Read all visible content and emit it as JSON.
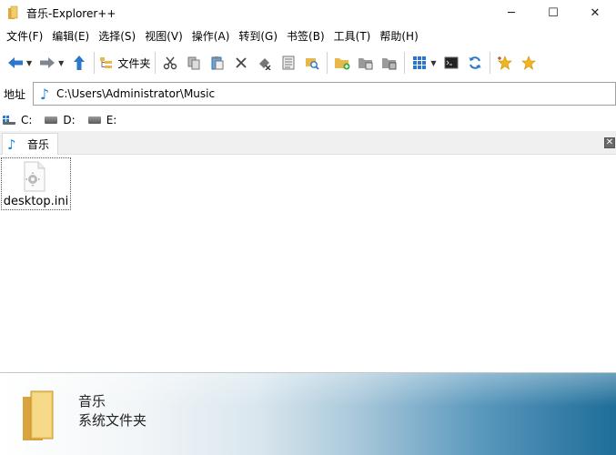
{
  "window": {
    "title": "音乐-Explorer++",
    "minimize_glyph": "─",
    "maximize_glyph": "☐",
    "close_glyph": "✕"
  },
  "menu": {
    "items": [
      "文件(F)",
      "编辑(E)",
      "选择(S)",
      "视图(V)",
      "操作(A)",
      "转到(G)",
      "书签(B)",
      "工具(T)",
      "帮助(H)"
    ]
  },
  "toolbar": {
    "folders_label": "文件夹",
    "icons": [
      "back-arrow-icon",
      "forward-arrow-icon",
      "up-arrow-icon",
      "folders-icon",
      "cut-icon",
      "copy-icon",
      "paste-icon",
      "delete-icon",
      "delete-permanently-icon",
      "properties-icon",
      "search-icon",
      "new-folder-icon",
      "copy-to-icon",
      "move-to-icon",
      "views-icon",
      "command-prompt-icon",
      "refresh-icon",
      "bookmark-add-icon",
      "bookmarks-icon"
    ]
  },
  "address": {
    "label": "地址",
    "value": "C:\\Users\\Administrator\\Music"
  },
  "drives": [
    {
      "label": "C:"
    },
    {
      "label": "D:"
    },
    {
      "label": "E:"
    }
  ],
  "tabs": [
    {
      "label": "音乐"
    }
  ],
  "files": [
    {
      "name": "desktop.ini"
    }
  ],
  "display": {
    "name": "音乐",
    "type": "系统文件夹"
  },
  "colors": {
    "accent_blue": "#1a7fd4",
    "folder_yellow": "#e8b84a"
  }
}
